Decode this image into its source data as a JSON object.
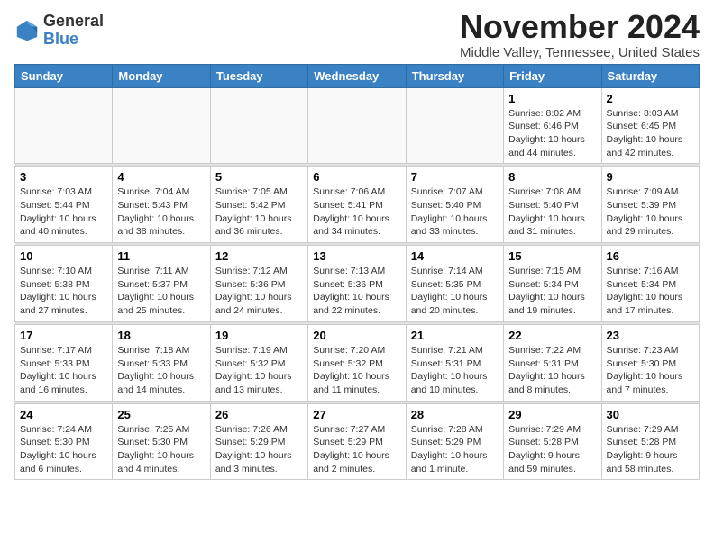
{
  "logo": {
    "general": "General",
    "blue": "Blue"
  },
  "header": {
    "month": "November 2024",
    "location": "Middle Valley, Tennessee, United States"
  },
  "weekdays": [
    "Sunday",
    "Monday",
    "Tuesday",
    "Wednesday",
    "Thursday",
    "Friday",
    "Saturday"
  ],
  "weeks": [
    [
      {
        "day": "",
        "info": ""
      },
      {
        "day": "",
        "info": ""
      },
      {
        "day": "",
        "info": ""
      },
      {
        "day": "",
        "info": ""
      },
      {
        "day": "",
        "info": ""
      },
      {
        "day": "1",
        "info": "Sunrise: 8:02 AM\nSunset: 6:46 PM\nDaylight: 10 hours\nand 44 minutes."
      },
      {
        "day": "2",
        "info": "Sunrise: 8:03 AM\nSunset: 6:45 PM\nDaylight: 10 hours\nand 42 minutes."
      }
    ],
    [
      {
        "day": "3",
        "info": "Sunrise: 7:03 AM\nSunset: 5:44 PM\nDaylight: 10 hours\nand 40 minutes."
      },
      {
        "day": "4",
        "info": "Sunrise: 7:04 AM\nSunset: 5:43 PM\nDaylight: 10 hours\nand 38 minutes."
      },
      {
        "day": "5",
        "info": "Sunrise: 7:05 AM\nSunset: 5:42 PM\nDaylight: 10 hours\nand 36 minutes."
      },
      {
        "day": "6",
        "info": "Sunrise: 7:06 AM\nSunset: 5:41 PM\nDaylight: 10 hours\nand 34 minutes."
      },
      {
        "day": "7",
        "info": "Sunrise: 7:07 AM\nSunset: 5:40 PM\nDaylight: 10 hours\nand 33 minutes."
      },
      {
        "day": "8",
        "info": "Sunrise: 7:08 AM\nSunset: 5:40 PM\nDaylight: 10 hours\nand 31 minutes."
      },
      {
        "day": "9",
        "info": "Sunrise: 7:09 AM\nSunset: 5:39 PM\nDaylight: 10 hours\nand 29 minutes."
      }
    ],
    [
      {
        "day": "10",
        "info": "Sunrise: 7:10 AM\nSunset: 5:38 PM\nDaylight: 10 hours\nand 27 minutes."
      },
      {
        "day": "11",
        "info": "Sunrise: 7:11 AM\nSunset: 5:37 PM\nDaylight: 10 hours\nand 25 minutes."
      },
      {
        "day": "12",
        "info": "Sunrise: 7:12 AM\nSunset: 5:36 PM\nDaylight: 10 hours\nand 24 minutes."
      },
      {
        "day": "13",
        "info": "Sunrise: 7:13 AM\nSunset: 5:36 PM\nDaylight: 10 hours\nand 22 minutes."
      },
      {
        "day": "14",
        "info": "Sunrise: 7:14 AM\nSunset: 5:35 PM\nDaylight: 10 hours\nand 20 minutes."
      },
      {
        "day": "15",
        "info": "Sunrise: 7:15 AM\nSunset: 5:34 PM\nDaylight: 10 hours\nand 19 minutes."
      },
      {
        "day": "16",
        "info": "Sunrise: 7:16 AM\nSunset: 5:34 PM\nDaylight: 10 hours\nand 17 minutes."
      }
    ],
    [
      {
        "day": "17",
        "info": "Sunrise: 7:17 AM\nSunset: 5:33 PM\nDaylight: 10 hours\nand 16 minutes."
      },
      {
        "day": "18",
        "info": "Sunrise: 7:18 AM\nSunset: 5:33 PM\nDaylight: 10 hours\nand 14 minutes."
      },
      {
        "day": "19",
        "info": "Sunrise: 7:19 AM\nSunset: 5:32 PM\nDaylight: 10 hours\nand 13 minutes."
      },
      {
        "day": "20",
        "info": "Sunrise: 7:20 AM\nSunset: 5:32 PM\nDaylight: 10 hours\nand 11 minutes."
      },
      {
        "day": "21",
        "info": "Sunrise: 7:21 AM\nSunset: 5:31 PM\nDaylight: 10 hours\nand 10 minutes."
      },
      {
        "day": "22",
        "info": "Sunrise: 7:22 AM\nSunset: 5:31 PM\nDaylight: 10 hours\nand 8 minutes."
      },
      {
        "day": "23",
        "info": "Sunrise: 7:23 AM\nSunset: 5:30 PM\nDaylight: 10 hours\nand 7 minutes."
      }
    ],
    [
      {
        "day": "24",
        "info": "Sunrise: 7:24 AM\nSunset: 5:30 PM\nDaylight: 10 hours\nand 6 minutes."
      },
      {
        "day": "25",
        "info": "Sunrise: 7:25 AM\nSunset: 5:30 PM\nDaylight: 10 hours\nand 4 minutes."
      },
      {
        "day": "26",
        "info": "Sunrise: 7:26 AM\nSunset: 5:29 PM\nDaylight: 10 hours\nand 3 minutes."
      },
      {
        "day": "27",
        "info": "Sunrise: 7:27 AM\nSunset: 5:29 PM\nDaylight: 10 hours\nand 2 minutes."
      },
      {
        "day": "28",
        "info": "Sunrise: 7:28 AM\nSunset: 5:29 PM\nDaylight: 10 hours\nand 1 minute."
      },
      {
        "day": "29",
        "info": "Sunrise: 7:29 AM\nSunset: 5:28 PM\nDaylight: 9 hours\nand 59 minutes."
      },
      {
        "day": "30",
        "info": "Sunrise: 7:29 AM\nSunset: 5:28 PM\nDaylight: 9 hours\nand 58 minutes."
      }
    ]
  ]
}
